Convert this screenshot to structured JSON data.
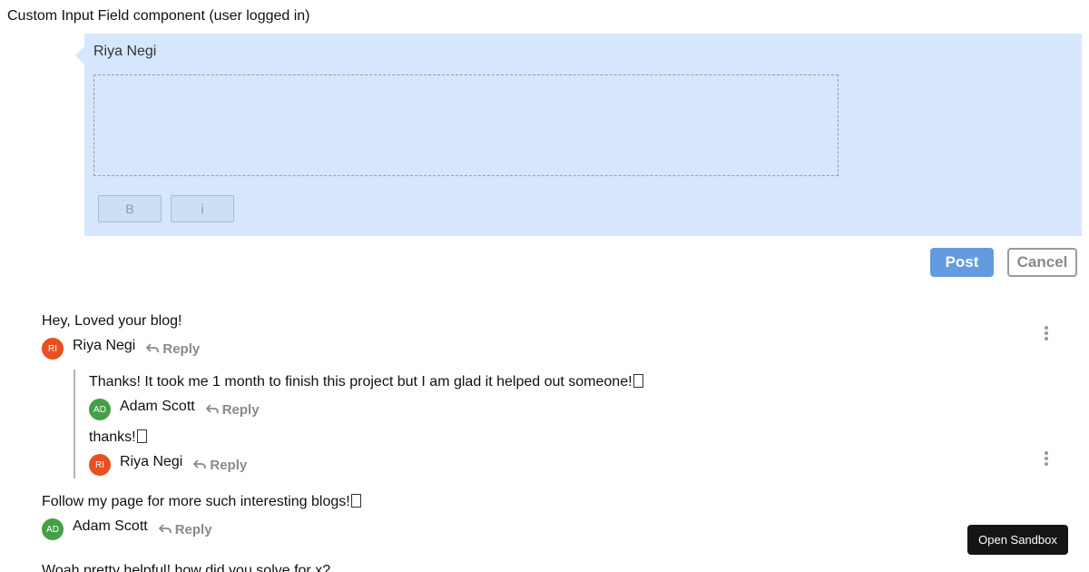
{
  "page": {
    "heading": "Custom Input Field component (user logged in)"
  },
  "input_panel": {
    "user_name": "Riya Negi",
    "editor_placeholder": "",
    "format_buttons": [
      "B",
      "i"
    ],
    "post_label": "Post",
    "cancel_label": "Cancel"
  },
  "comments": [
    {
      "text": "Hey, Loved your blog!",
      "author": "Riya Negi",
      "initials": "RI",
      "reply_label": "Reply",
      "replies": [
        {
          "text": "Thanks! It took me 1 month to finish this project but I am glad it helped out someone!",
          "author": "Adam Scott",
          "initials": "AD",
          "reply_label": "Reply"
        },
        {
          "text": "thanks!",
          "author": "Riya Negi",
          "initials": "RI",
          "reply_label": "Reply"
        }
      ]
    },
    {
      "text": "Follow my page for more such interesting blogs!",
      "author": "Adam Scott",
      "initials": "AD",
      "reply_label": "Reply",
      "replies": []
    },
    {
      "text": "Woah pretty helpful! how did you solve for x?",
      "author": "",
      "initials": "",
      "reply_label": "",
      "replies": []
    }
  ],
  "sandbox": {
    "label": "Open Sandbox"
  },
  "icons": {
    "reply": "reply-arrow-icon",
    "more": "more-vertical-icon"
  },
  "colors": {
    "panel_bg": "#d6e7fd",
    "post_bg": "#649ae0",
    "avatar_orange": "#e8501e",
    "avatar_green": "#43a047"
  }
}
